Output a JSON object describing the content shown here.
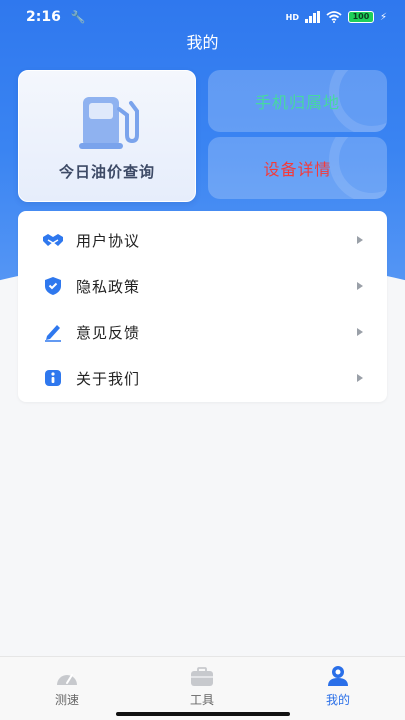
{
  "status_bar": {
    "time": "2:16",
    "network": "HD",
    "battery": "100"
  },
  "header": {
    "title": "我的"
  },
  "cards": {
    "fuel_price": {
      "label": "今日油价查询",
      "icon": "fuel-pump-icon"
    },
    "phone_location": {
      "label": "手机归属地"
    },
    "device_details": {
      "label": "设备详情"
    }
  },
  "menu": {
    "items": [
      {
        "label": "用户协议",
        "icon": "handshake-icon"
      },
      {
        "label": "隐私政策",
        "icon": "shield-icon"
      },
      {
        "label": "意见反馈",
        "icon": "pen-icon"
      },
      {
        "label": "关于我们",
        "icon": "info-icon"
      }
    ]
  },
  "tabbar": {
    "tabs": [
      {
        "label": "测速",
        "icon": "speedometer-icon"
      },
      {
        "label": "工具",
        "icon": "toolbox-icon"
      },
      {
        "label": "我的",
        "icon": "user-icon"
      }
    ],
    "active_index": 2
  },
  "colors": {
    "accent": "#2f78ee",
    "phone_label": "#46d9a0",
    "device_label": "#f43b3b",
    "active_tab": "#2a6fe8"
  }
}
